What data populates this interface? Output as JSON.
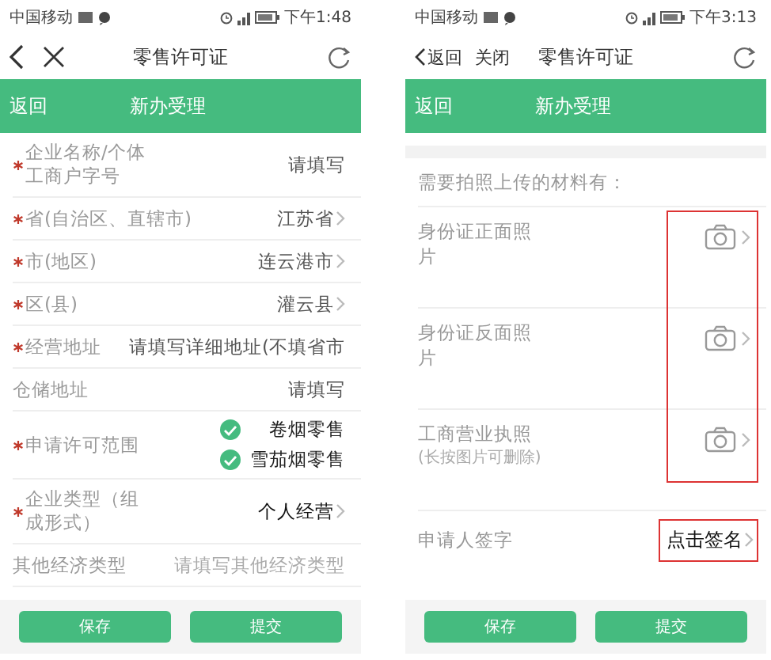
{
  "screens": [
    {
      "status_bar": {
        "carrier": "中国移动",
        "time": "下午1:48"
      },
      "nav_bar": {
        "title": "零售许可证"
      },
      "header": {
        "back": "返回",
        "title": "新办受理"
      },
      "fields": [
        {
          "kind": "input",
          "required": true,
          "label": "企业名称/个体工商户字号",
          "label_wraps": true,
          "value": "请填写"
        },
        {
          "kind": "select",
          "required": true,
          "label": "省(自治区、直辖市)",
          "value": "江苏省"
        },
        {
          "kind": "select",
          "required": true,
          "label": "市(地区)",
          "value": "连云港市"
        },
        {
          "kind": "select",
          "required": true,
          "label": "区(县)",
          "value": "灌云县"
        },
        {
          "kind": "input",
          "required": true,
          "label": "经营地址",
          "value": "请填写详细地址(不填省市"
        },
        {
          "kind": "input",
          "required": false,
          "label": "仓储地址",
          "value": "请填写"
        },
        {
          "kind": "checks",
          "required": true,
          "label": "申请许可范围",
          "options": [
            {
              "label": "卷烟零售",
              "checked": true
            },
            {
              "label": "雪茄烟零售",
              "checked": true
            }
          ]
        },
        {
          "kind": "select",
          "required": true,
          "label": "企业类型（组成形式）",
          "label_wraps": true,
          "value": "个人经营",
          "filled": true
        },
        {
          "kind": "placeholder",
          "required": false,
          "label": "其他经济类型",
          "placeholder": "请填写其他经济类型"
        }
      ],
      "buttons": [
        "保存",
        "提交"
      ]
    },
    {
      "status_bar": {
        "carrier": "中国移动",
        "time": "下午3:13"
      },
      "nav_bar": {
        "title": "零售许可证",
        "back_label": "返回",
        "close_label": "关闭"
      },
      "header": {
        "back": "返回",
        "title": "新办受理"
      },
      "upload_heading": "需要拍照上传的材料有：",
      "uploads": {
        "highlighted": true,
        "items": [
          {
            "label": "身份证正面照片"
          },
          {
            "label": "身份证反面照片"
          },
          {
            "label": "工商营业执照",
            "note": "(长按图片可删除)"
          }
        ]
      },
      "signature": {
        "label": "申请人签字",
        "action": "点击签名",
        "highlighted": true
      },
      "buttons": [
        "保存",
        "提交"
      ]
    }
  ]
}
